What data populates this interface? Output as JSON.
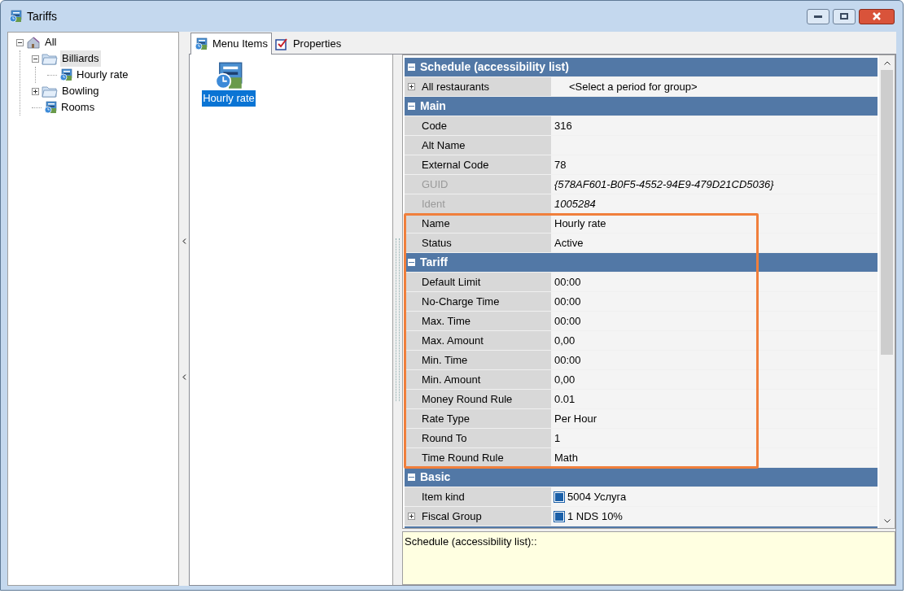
{
  "window": {
    "title": "Tariffs"
  },
  "tree": [
    {
      "label": "All",
      "kind": "home",
      "expanded": true,
      "selected": false,
      "children": [
        {
          "label": "Billiards",
          "kind": "folder",
          "expanded": true,
          "selected": true,
          "children": [
            {
              "label": "Hourly rate",
              "kind": "tariff",
              "selected": false
            }
          ]
        },
        {
          "label": "Bowling",
          "kind": "folder",
          "expanded": false,
          "selected": false
        },
        {
          "label": "Rooms",
          "kind": "tariff",
          "selected": false
        }
      ]
    }
  ],
  "tabs": [
    {
      "label": "Menu Items",
      "kind": "tariff",
      "selected": true
    },
    {
      "label": "Properties",
      "kind": "check",
      "selected": false
    }
  ],
  "items": [
    {
      "label": "Hourly rate",
      "selected": true
    }
  ],
  "property_grid": {
    "categories": [
      {
        "title": "Schedule (accessibility list)",
        "expanded": true,
        "rows": [
          {
            "label": "All restaurants",
            "value": "<Select a period for group>",
            "collapsed": true,
            "indent_value": true
          }
        ]
      },
      {
        "title": "Main",
        "expanded": true,
        "rows": [
          {
            "label": "Code",
            "value": "316"
          },
          {
            "label": "Alt Name",
            "value": ""
          },
          {
            "label": "External Code",
            "value": "78"
          },
          {
            "label": "GUID",
            "value": "{578AF601-B0F5-4552-94E9-479D21CD5036}",
            "disabled": true
          },
          {
            "label": "Ident",
            "value": "1005284",
            "disabled": true
          },
          {
            "label": "Name",
            "value": "Hourly rate"
          },
          {
            "label": "Status",
            "value": "Active"
          }
        ]
      },
      {
        "title": "Tariff",
        "expanded": true,
        "rows": [
          {
            "label": "Default Limit",
            "value": "00:00"
          },
          {
            "label": "No-Charge Time",
            "value": "00:00"
          },
          {
            "label": "Max. Time",
            "value": "00:00"
          },
          {
            "label": "Max. Amount",
            "value": "0,00"
          },
          {
            "label": "Min. Time",
            "value": "00:00"
          },
          {
            "label": "Min. Amount",
            "value": "0,00"
          },
          {
            "label": "Money Round Rule",
            "value": "0.01"
          },
          {
            "label": "Rate Type",
            "value": "Per Hour"
          },
          {
            "label": "Round To",
            "value": "1"
          },
          {
            "label": "Time Round Rule",
            "value": "Math"
          }
        ]
      },
      {
        "title": "Basic",
        "expanded": true,
        "rows": [
          {
            "label": "Item kind",
            "value": "5004 Услуга",
            "value_icon": true
          },
          {
            "label": "Fiscal Group",
            "value": "1 NDS 10%",
            "value_icon": true,
            "collapsed": true
          }
        ]
      }
    ]
  },
  "description": "Schedule (accessibility list)::"
}
